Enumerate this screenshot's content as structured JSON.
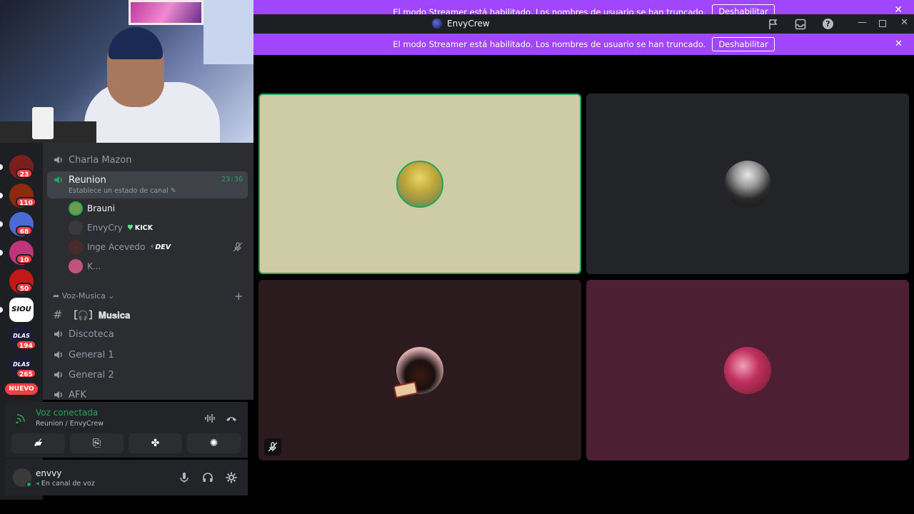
{
  "window": {
    "title": "EnvyCrew",
    "controls": [
      "minimize",
      "maximize",
      "close"
    ],
    "toolbar_icons": [
      "flag-icon",
      "inbox-icon",
      "help-icon"
    ]
  },
  "banner": {
    "text": "El modo Streamer está habilitado. Los nombres de usuario se han truncado.",
    "button": "Deshabilitar"
  },
  "servers": [
    {
      "badge": "23",
      "color": "#7a1e1e"
    },
    {
      "badge": "110",
      "color": "#8a2b10"
    },
    {
      "badge": "68",
      "color": "#4a6bd6"
    },
    {
      "badge": "10",
      "color": "#c2347a"
    },
    {
      "badge": "50",
      "color": "#c21818"
    },
    {
      "badge": "",
      "color": "#ffffff",
      "label": "SIOU"
    },
    {
      "badge": "194",
      "color": "#1b1b3a",
      "label": "DLAS"
    },
    {
      "badge": "265",
      "color": "#1b1b3a",
      "label": "DLAS"
    }
  ],
  "nuevo_label": "NUEVO",
  "channels": {
    "charla": "Charla Mazon",
    "reunion": {
      "name": "Reunion",
      "timer": "23:36",
      "status_hint": "Establece un estado de canal"
    },
    "users": [
      {
        "name": "Brauni",
        "tag": "",
        "color": "#6a9e4a"
      },
      {
        "name": "EnvyCry",
        "tag": "KICK",
        "tag_icon": "green-heart-icon",
        "color": "#3a3a3a"
      },
      {
        "name": "Inge Acevedo",
        "tag": "DEV",
        "tag_icon": "lightning-icon",
        "color": "#4a2b2b"
      },
      {
        "name": "K...",
        "tag": "",
        "color": "#c2547a"
      }
    ],
    "category": "Voz-Musica",
    "musica": "［🎧］𝐌𝐮𝐬𝐢𝐜𝐚",
    "others": [
      "Discoteca",
      "General 1",
      "General 2",
      "AFK"
    ]
  },
  "voice": {
    "status": "Voz conectada",
    "location": "Reunion / EnvyCrew"
  },
  "user": {
    "name": "envvy",
    "status": "En canal de voz"
  },
  "tiles": [
    {
      "bg": "#cdcca4",
      "avatar": "#d8c25a",
      "speaking": true
    },
    {
      "bg": "#232428",
      "avatar": "#3a3a3a",
      "speaking": false
    },
    {
      "bg": "#2b1a1e",
      "avatar": "#4a1a1a",
      "speaking": false,
      "muted": true
    },
    {
      "bg": "#4d1f32",
      "avatar": "#b0305a",
      "speaking": false
    }
  ]
}
